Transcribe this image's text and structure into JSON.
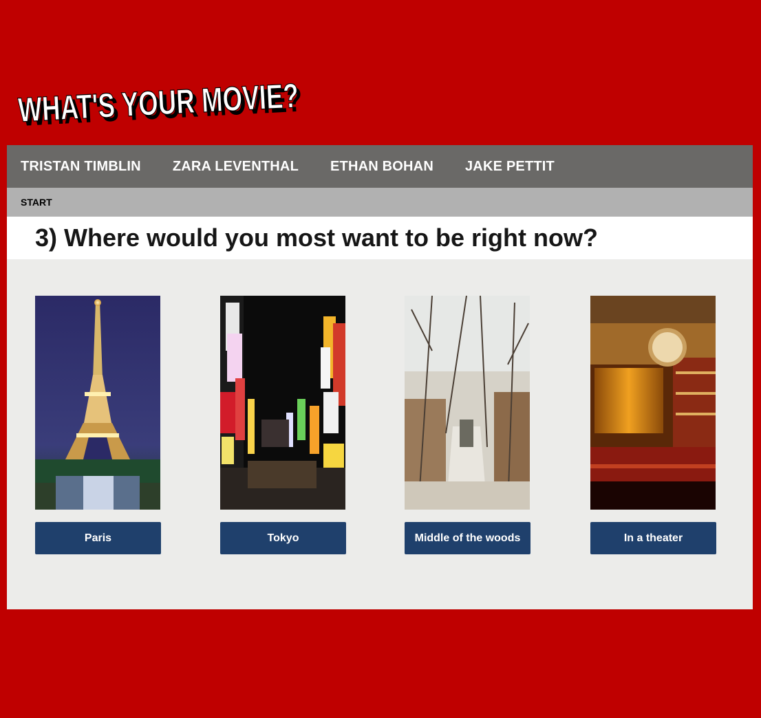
{
  "logo": {
    "text": "WHAT'S YOUR MOVIE?"
  },
  "nav": {
    "items": [
      {
        "label": "TRISTAN TIMBLIN"
      },
      {
        "label": "ZARA LEVENTHAL"
      },
      {
        "label": "ETHAN BOHAN"
      },
      {
        "label": "JAKE PETTIT"
      }
    ]
  },
  "subnav": {
    "start_label": "START"
  },
  "question": {
    "text": "3) Where would you most want to be right now?"
  },
  "choices": [
    {
      "label": "Paris",
      "image": "eiffel-tower-night"
    },
    {
      "label": "Tokyo",
      "image": "tokyo-neon-street"
    },
    {
      "label": "Middle of the woods",
      "image": "snowy-forest-stairs"
    },
    {
      "label": "In a theater",
      "image": "theater-interior"
    }
  ],
  "colors": {
    "page_background": "#bf0000",
    "nav_background": "#6a6967",
    "subnav_background": "#b1b1b1",
    "content_background": "#ececea",
    "button_background": "#1f406c"
  }
}
